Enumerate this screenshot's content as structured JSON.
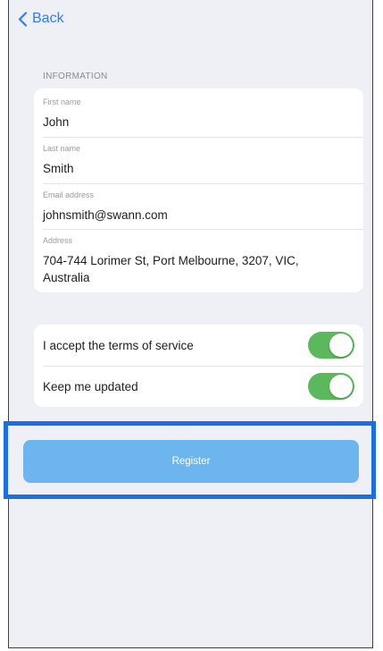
{
  "nav": {
    "back_label": "Back"
  },
  "information": {
    "header": "INFORMATION",
    "fields": [
      {
        "label": "First name",
        "value": "John"
      },
      {
        "label": "Last name",
        "value": "Smith"
      },
      {
        "label": "Email address",
        "value": "johnsmith@swann.com"
      },
      {
        "label": "Address",
        "value": "704-744 Lorimer St, Port Melbourne, 3207, VIC, Australia"
      }
    ]
  },
  "preferences": [
    {
      "label": "I accept the terms of service",
      "on": true
    },
    {
      "label": "Keep me updated",
      "on": true
    }
  ],
  "register_label": "Register",
  "colors": {
    "accent": "#2f7cf6",
    "toggle_on": "#5cb85c",
    "button": "#6db5ee",
    "highlight": "#1a6ee6",
    "background": "#eff0f5"
  }
}
